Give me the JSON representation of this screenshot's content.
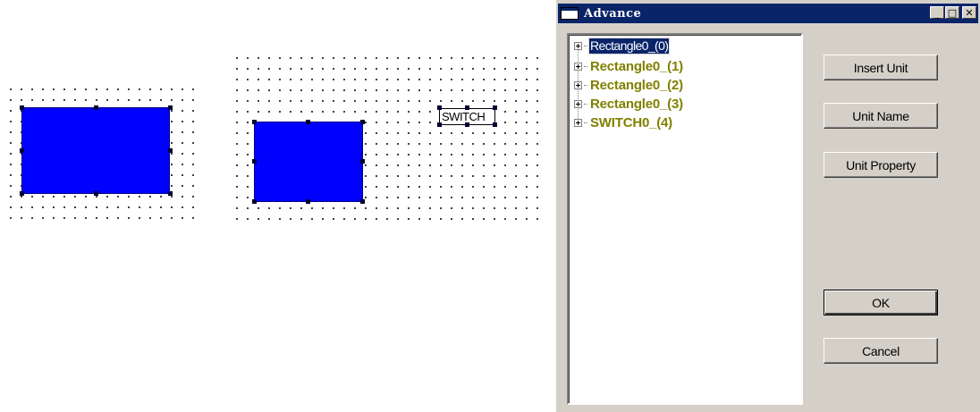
{
  "canvas": {
    "switch_label": "SWITCH"
  },
  "dialog": {
    "title": "Advance",
    "title_buttons": {
      "minimize": "_",
      "maximize": "□",
      "close": "✕"
    },
    "tree": [
      {
        "label": "Rectangle0_(0)",
        "selected": true
      },
      {
        "label": "Rectangle0_(1)",
        "selected": false
      },
      {
        "label": "Rectangle0_(2)",
        "selected": false
      },
      {
        "label": "Rectangle0_(3)",
        "selected": false
      },
      {
        "label": "SWITCH0_(4)",
        "selected": false
      }
    ],
    "buttons": {
      "insert_unit": "Insert Unit",
      "unit_name": "Unit Name",
      "unit_property": "Unit Property",
      "ok": "OK",
      "cancel": "Cancel"
    }
  },
  "colors": {
    "unit_fill": "#0000ff",
    "tree_text": "#808000",
    "titlebar": "#0a246a",
    "dialog_bg": "#d4d0c8"
  }
}
